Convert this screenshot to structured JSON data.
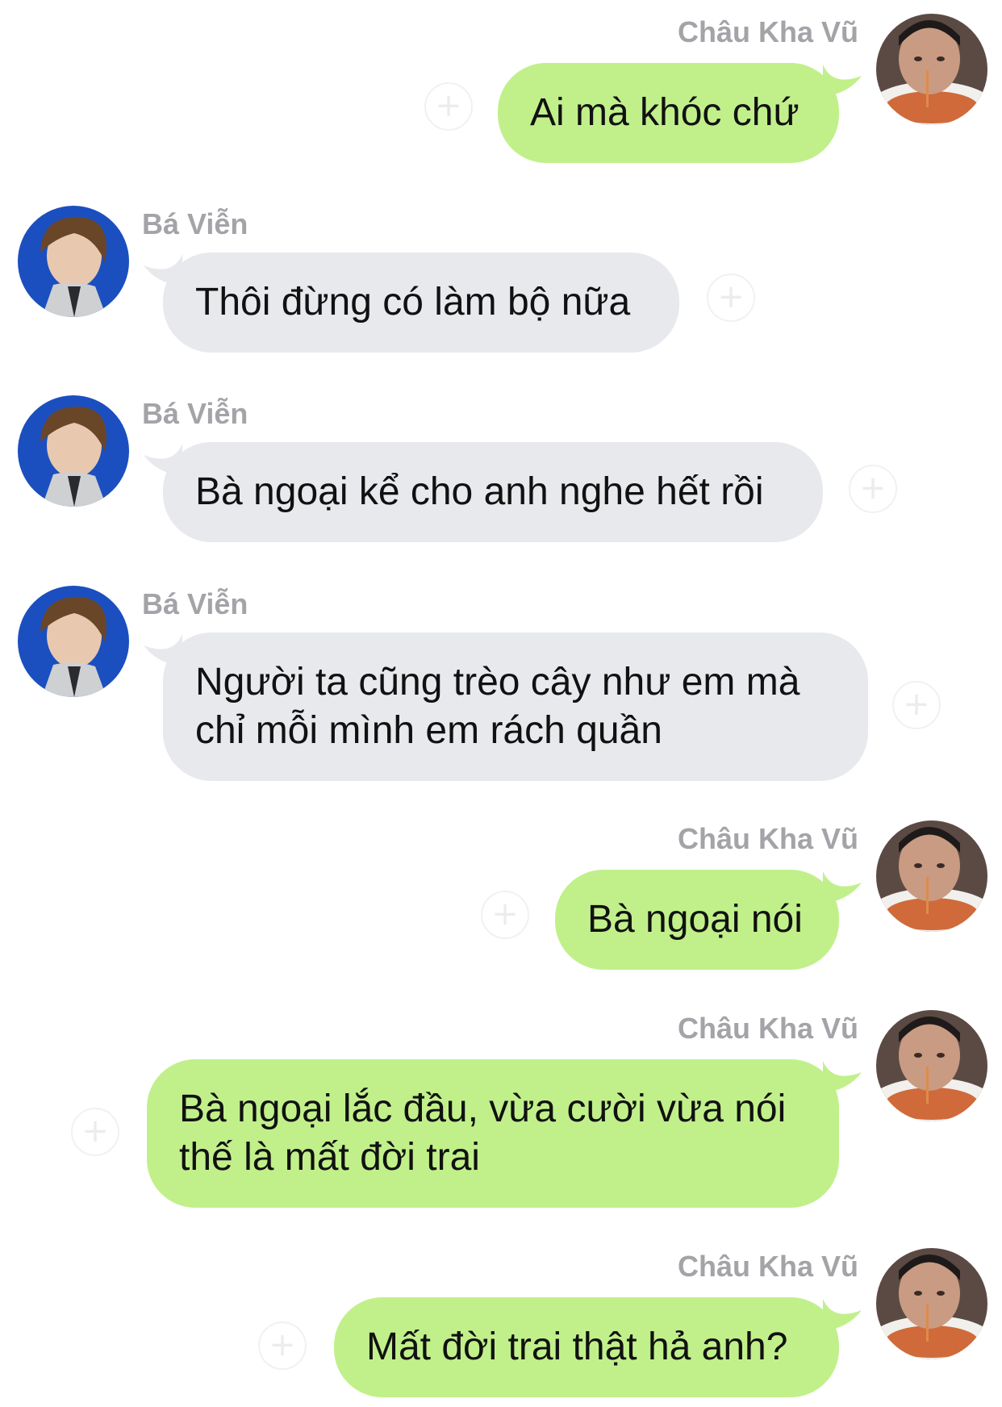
{
  "contacts": {
    "me": "Châu Kha Vũ",
    "other": "Bá Viễn"
  },
  "colors": {
    "outgoing_bubble": "#c1f08b",
    "incoming_bubble": "#e7e9ec",
    "sender_name": "#a3a3a8",
    "react_button": "#ececef"
  },
  "icons": {
    "react": "add-reaction-icon",
    "react_glyph": "+"
  },
  "messages": [
    {
      "sender": "Châu Kha Vũ",
      "direction": "outgoing",
      "text": "Ai mà khóc chứ"
    },
    {
      "sender": "Bá Viễn",
      "direction": "incoming",
      "text": "Thôi đừng có làm bộ nữa"
    },
    {
      "sender": "Bá Viễn",
      "direction": "incoming",
      "text": "Bà ngoại kể cho anh nghe hết rồi"
    },
    {
      "sender": "Bá Viễn",
      "direction": "incoming",
      "text": "Người ta cũng trèo cây như em mà\nchỉ mỗi mình em rách quần"
    },
    {
      "sender": "Châu Kha Vũ",
      "direction": "outgoing",
      "text": "Bà ngoại nói"
    },
    {
      "sender": "Châu Kha Vũ",
      "direction": "outgoing",
      "text": "Bà ngoại lắc đầu, vừa cười vừa nói\nthế là mất đời trai"
    },
    {
      "sender": "Châu Kha Vũ",
      "direction": "outgoing",
      "text": "Mất đời trai thật hả anh?"
    }
  ]
}
